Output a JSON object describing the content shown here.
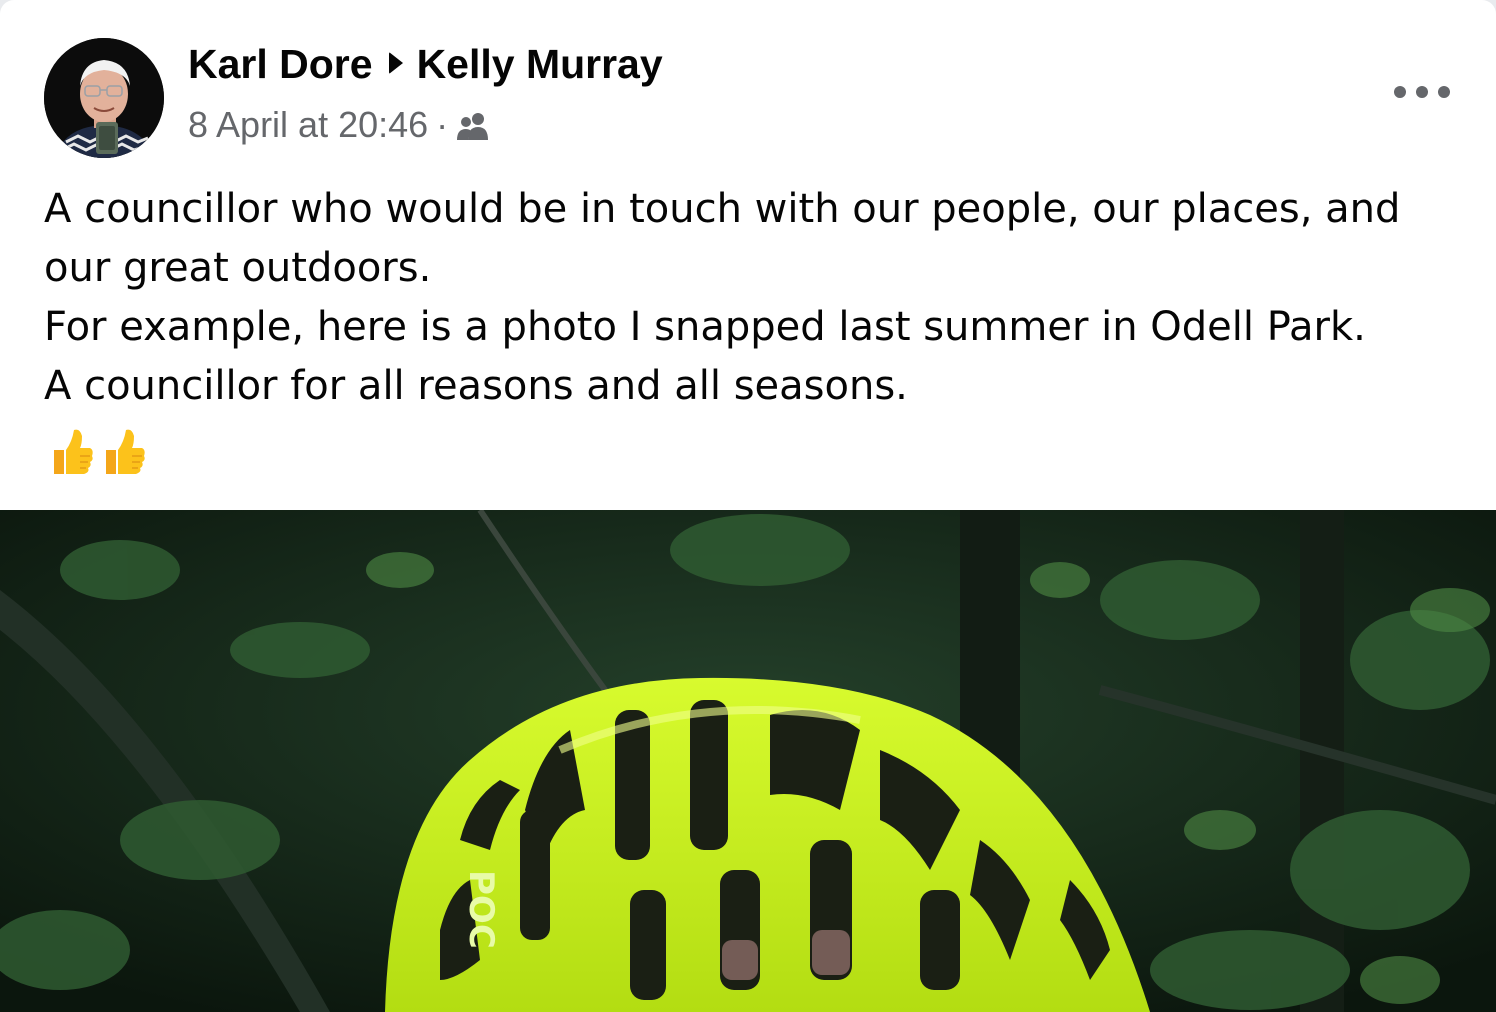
{
  "post": {
    "author": "Karl Dore",
    "recipient": "Kelly Murray",
    "timestamp": "8 April at 20:46",
    "separator": "·",
    "audience_icon": "friends-icon",
    "more_icon": "more-options-icon",
    "lines": [
      "A councillor who would be in touch with our people, our places, and",
      "our great outdoors.",
      "For example, here is a photo I snapped last summer in Odell Park.",
      "A councillor for all reasons and all seasons."
    ],
    "emoji": [
      "thumbs-up",
      "thumbs-up"
    ],
    "photo": {
      "description_icon": "cyclist-helmet-photo",
      "helmet_brand": "POC"
    }
  },
  "colors": {
    "text_primary": "#050505",
    "text_secondary": "#65676b",
    "helmet": "#c9f21d",
    "foliage": "#1c3a1f"
  }
}
